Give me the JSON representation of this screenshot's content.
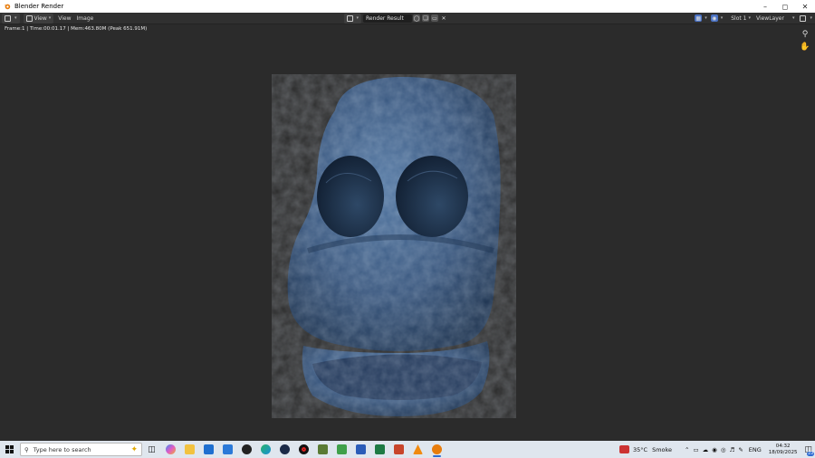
{
  "window": {
    "title": "Blender Render",
    "controls": [
      "minimize",
      "maximize",
      "close"
    ]
  },
  "header": {
    "menus": [
      "View",
      "View",
      "Image"
    ],
    "image_name": "Render Result",
    "slot": "Slot 1",
    "view_layer": "ViewLayer"
  },
  "viewport": {
    "status": "Frame:1 | Time:00:01.17 | Mem:463.80M (Peak 651.91M)",
    "icons": [
      "zoom-icon",
      "hand-icon"
    ]
  },
  "taskbar": {
    "search_placeholder": "Type here to search",
    "apps": [
      "task-view",
      "browser-copilot",
      "file-explorer",
      "mail",
      "store",
      "app-dark",
      "edge",
      "steam",
      "record",
      "minecraft",
      "notepad-green",
      "word",
      "excel",
      "powerpoint",
      "vlc",
      "blender"
    ],
    "weather": {
      "temp": "35°C",
      "desc": "Smoke"
    },
    "language": "ENG",
    "time": "04:32",
    "date": "18/09/2025",
    "notifications": "23"
  },
  "colors": {
    "viewport_bg": "#2b2b2b",
    "header_bg": "#303030",
    "taskbar_bg": "#dfe6ee",
    "blender_orange": "#e87d0d",
    "object_blue": "#3d5f8a"
  }
}
